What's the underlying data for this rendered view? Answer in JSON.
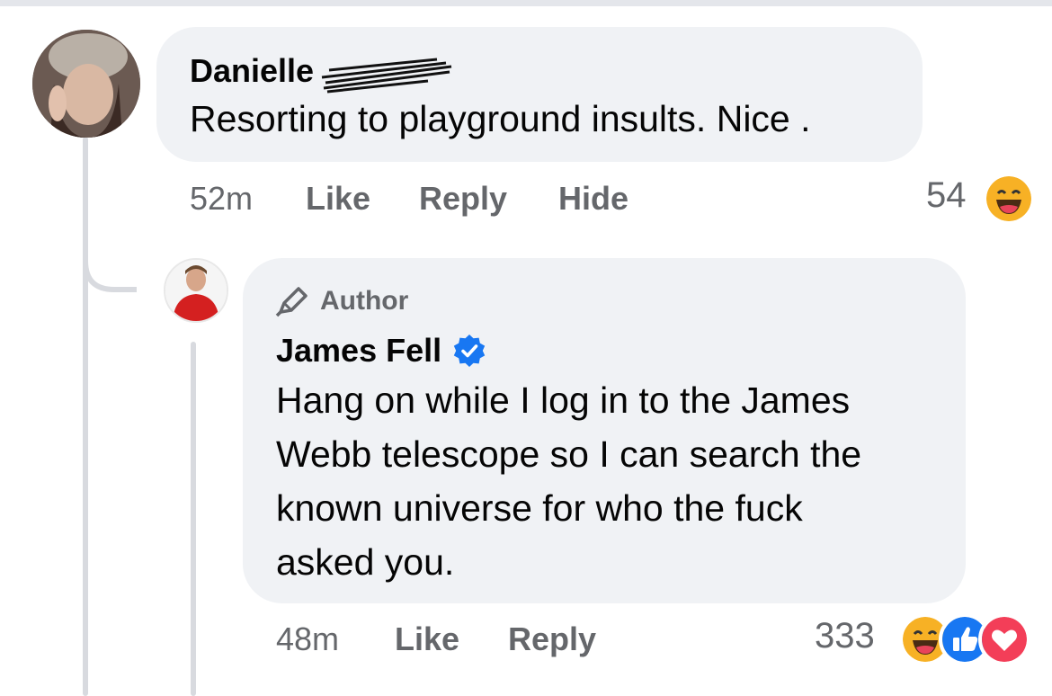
{
  "comment1": {
    "author_name": "Danielle",
    "text": "Resorting to playground insults. Nice .",
    "time": "52m",
    "like_label": "Like",
    "reply_label": "Reply",
    "hide_label": "Hide",
    "reaction_count": "54",
    "reactions": [
      "haha-icon"
    ]
  },
  "reply1": {
    "badge_label": "Author",
    "author_name": "James Fell",
    "verified": true,
    "text_lines": [
      "Hang on while I log in to the James",
      "Webb telescope so I can search the",
      "known universe for who the fuck",
      "asked you."
    ],
    "time": "48m",
    "like_label": "Like",
    "reply_label": "Reply",
    "reaction_count": "333",
    "reactions": [
      "haha-icon",
      "like-icon",
      "love-icon"
    ]
  },
  "colors": {
    "bubble": "#f0f2f5",
    "meta_text": "#65676b",
    "verified_blue": "#1877f2",
    "like_blue": "#1877f2",
    "love_red": "#f33e58",
    "haha_yellow": "#f7b125"
  }
}
